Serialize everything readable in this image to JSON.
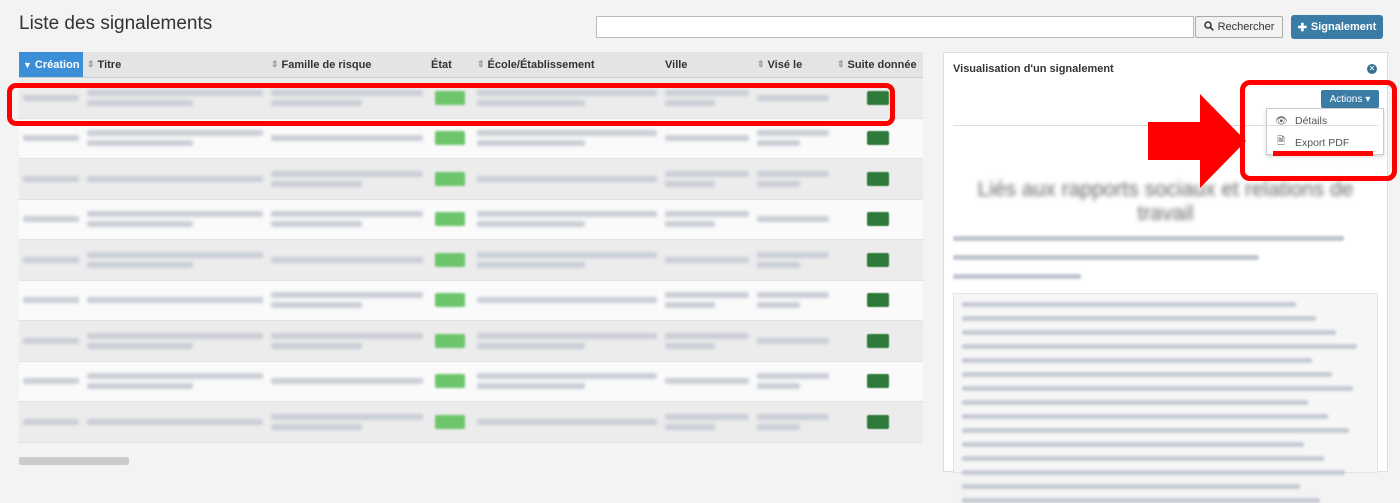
{
  "header": {
    "title": "Liste des signalements",
    "search": {
      "value": "",
      "placeholder": ""
    },
    "search_button": {
      "label": "Rechercher",
      "icon": "search-icon"
    },
    "new_button": {
      "label": "Signalement",
      "icon": "plus-icon"
    }
  },
  "table": {
    "columns": [
      {
        "label": "Création",
        "sorted": "desc"
      },
      {
        "label": "Titre",
        "sortable": true
      },
      {
        "label": "Famille de risque",
        "sortable": true
      },
      {
        "label": "État",
        "sortable": false
      },
      {
        "label": "École/Établissement",
        "sortable": true
      },
      {
        "label": "Ville",
        "sortable": false
      },
      {
        "label": "Visé le",
        "sortable": true
      },
      {
        "label": "Suite donnée",
        "sortable": true
      }
    ],
    "row_count": 9,
    "note": "cell contents are blurred in the screenshot"
  },
  "panel": {
    "title": "Visualisation d'un signalement",
    "actions_button": {
      "label": "Actions",
      "icon": "caret-down-icon"
    },
    "dropdown": [
      {
        "label": "Détails",
        "icon": "eye-icon"
      },
      {
        "label": "Export PDF",
        "icon": "pdf-file-icon"
      }
    ],
    "heading": "Liés aux rapports sociaux et relations de travail"
  },
  "colors": {
    "accent": "#3a7ca5",
    "sort_active": "#3a8fd6",
    "etat_badge": "#6cc56c",
    "suite_badge": "#2d7a3a",
    "annotation": "#ff0000"
  }
}
